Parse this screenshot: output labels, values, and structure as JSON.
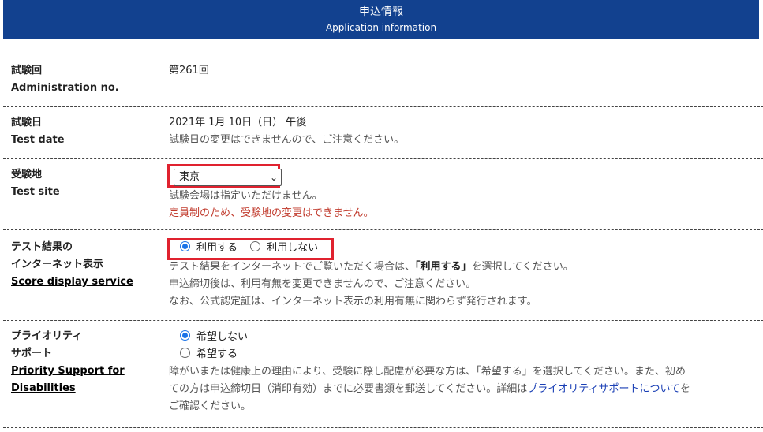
{
  "header": {
    "title": "申込情報",
    "subtitle": "Application information"
  },
  "administration": {
    "label_jp": "試験回",
    "label_en": "Administration no.",
    "value": "第261回"
  },
  "test_date": {
    "label_jp": "試験日",
    "label_en": "Test date",
    "value": "2021年 1月 10日（日） 午後",
    "note": "試験日の変更はできませんので、ご注意ください。"
  },
  "test_site": {
    "label_jp": "受験地",
    "label_en": "Test site",
    "selected": "東京",
    "note": "試験会場は指定いただけません。",
    "warning": "定員制のため、受験地の変更はできません。"
  },
  "score_display": {
    "label_jp_1": "テスト結果の",
    "label_jp_2": "インターネット表示",
    "label_en": "Score display service",
    "option_use": "利用する",
    "option_not_use": "利用しない",
    "selected": "利用する",
    "note1_pre": "テスト結果をインターネットでご覧いただく場合は、",
    "note1_strong": "「利用する」",
    "note1_post": "を選択してください。",
    "note2": "申込締切後は、利用有無を変更できませんので、ご注意ください。",
    "note3": "なお、公式認定証は、インターネット表示の利用有無に関わらず発行されます。"
  },
  "priority_support": {
    "label_jp_1": "プライオリティ",
    "label_jp_2": "サポート",
    "label_en_1": "Priority Support for",
    "label_en_2": "Disabilities",
    "option_no": "希望しない",
    "option_yes": "希望する",
    "selected": "希望しない",
    "note_line1": "障がいまたは健康上の理由により、受験に際し配慮が必要な方は、「希望する」を選択してください。また、初め",
    "note_line2_pre": "ての方は申込締切日（消印有効）までに必要書類を郵送してください。詳細は",
    "note_link": "プライオリティサポートについて",
    "note_line2_post": "を",
    "note_line3": "ご確認ください。"
  }
}
